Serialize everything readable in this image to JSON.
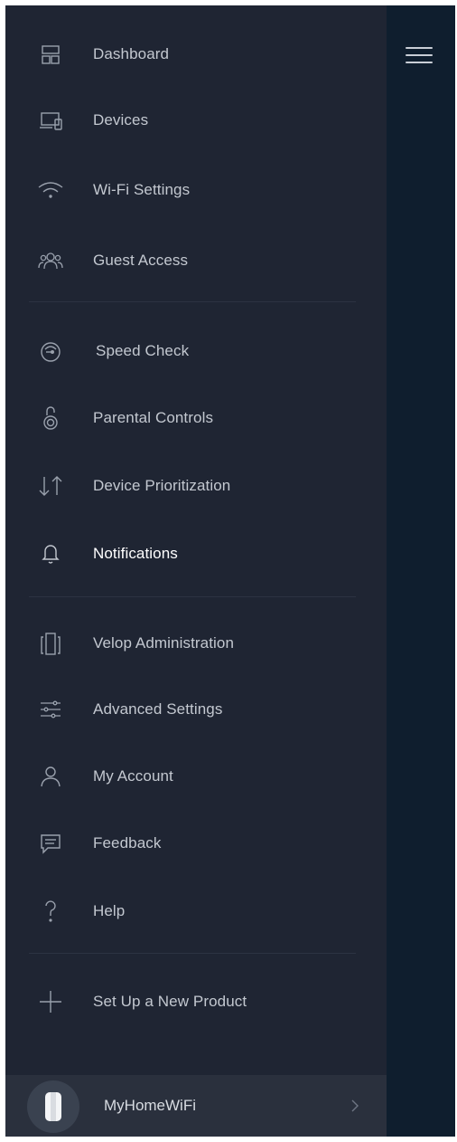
{
  "header": {
    "menu_icon": "hamburger-menu-icon"
  },
  "menu": {
    "items": [
      {
        "label": "Dashboard",
        "icon": "dashboard-icon"
      },
      {
        "label": "Devices",
        "icon": "devices-icon"
      },
      {
        "label": "Wi-Fi Settings",
        "icon": "wifi-icon"
      },
      {
        "label": "Guest Access",
        "icon": "guest-access-icon"
      },
      {
        "label": "Speed Check",
        "icon": "speedometer-icon"
      },
      {
        "label": "Parental Controls",
        "icon": "parental-lock-icon"
      },
      {
        "label": "Device Prioritization",
        "icon": "priority-arrows-icon"
      },
      {
        "label": "Notifications",
        "icon": "bell-icon",
        "active": true
      },
      {
        "label": "Velop Administration",
        "icon": "velop-node-icon"
      },
      {
        "label": "Advanced Settings",
        "icon": "sliders-icon"
      },
      {
        "label": "My Account",
        "icon": "user-icon"
      },
      {
        "label": "Feedback",
        "icon": "feedback-bubble-icon"
      },
      {
        "label": "Help",
        "icon": "question-mark-icon"
      },
      {
        "label": "Set Up a New Product",
        "icon": "plus-icon"
      }
    ]
  },
  "network": {
    "name": "MyHomeWiFi",
    "icon": "velop-node-avatar-icon",
    "chevron": "chevron-right-icon"
  },
  "colors": {
    "drawer_bg": "#1f2533",
    "panel_bg": "#0f1e2e",
    "text": "#c3c8d0",
    "active_text": "#ffffff",
    "icon": "#9aa1ad"
  }
}
